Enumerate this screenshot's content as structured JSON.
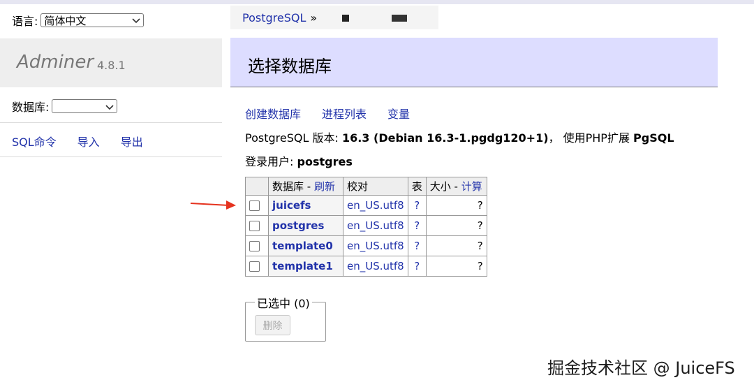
{
  "language": {
    "label": "语言:",
    "selected": "简体中文"
  },
  "app": {
    "name": "Adminer",
    "version": "4.8.1"
  },
  "database_select": {
    "label": "数据库:",
    "selected": ""
  },
  "left_links": [
    "SQL命令",
    "导入",
    "导出"
  ],
  "breadcrumb": {
    "system": "PostgreSQL",
    "separator": "»"
  },
  "page_title": "选择数据库",
  "actions": [
    "创建数据库",
    "进程列表",
    "变量"
  ],
  "version_line": {
    "prefix": "PostgreSQL 版本:",
    "version": "16.3 (Debian 16.3-1.pgdg120+1)",
    "middle": "，  使用PHP扩展",
    "extension": "PgSQL"
  },
  "login": {
    "label": "登录用户:",
    "user": "postgres"
  },
  "table": {
    "headers": {
      "database": "数据库",
      "refresh": "刷新",
      "collation": "校对",
      "tables": "表",
      "size": "大小",
      "compute": "计算"
    },
    "rows": [
      {
        "name": "juicefs",
        "collation": "en_US.utf8",
        "tables": "?",
        "size": "?"
      },
      {
        "name": "postgres",
        "collation": "en_US.utf8",
        "tables": "?",
        "size": "?"
      },
      {
        "name": "template0",
        "collation": "en_US.utf8",
        "tables": "?",
        "size": "?"
      },
      {
        "name": "template1",
        "collation": "en_US.utf8",
        "tables": "?",
        "size": "?"
      }
    ]
  },
  "selected": {
    "legend": "已选中 (0)",
    "delete_label": "删除"
  },
  "watermark": "掘金技术社区 @ JuiceFS",
  "colors": {
    "link": "#2233aa",
    "title_bg": "#ddddff",
    "arrow": "#e5331f"
  }
}
